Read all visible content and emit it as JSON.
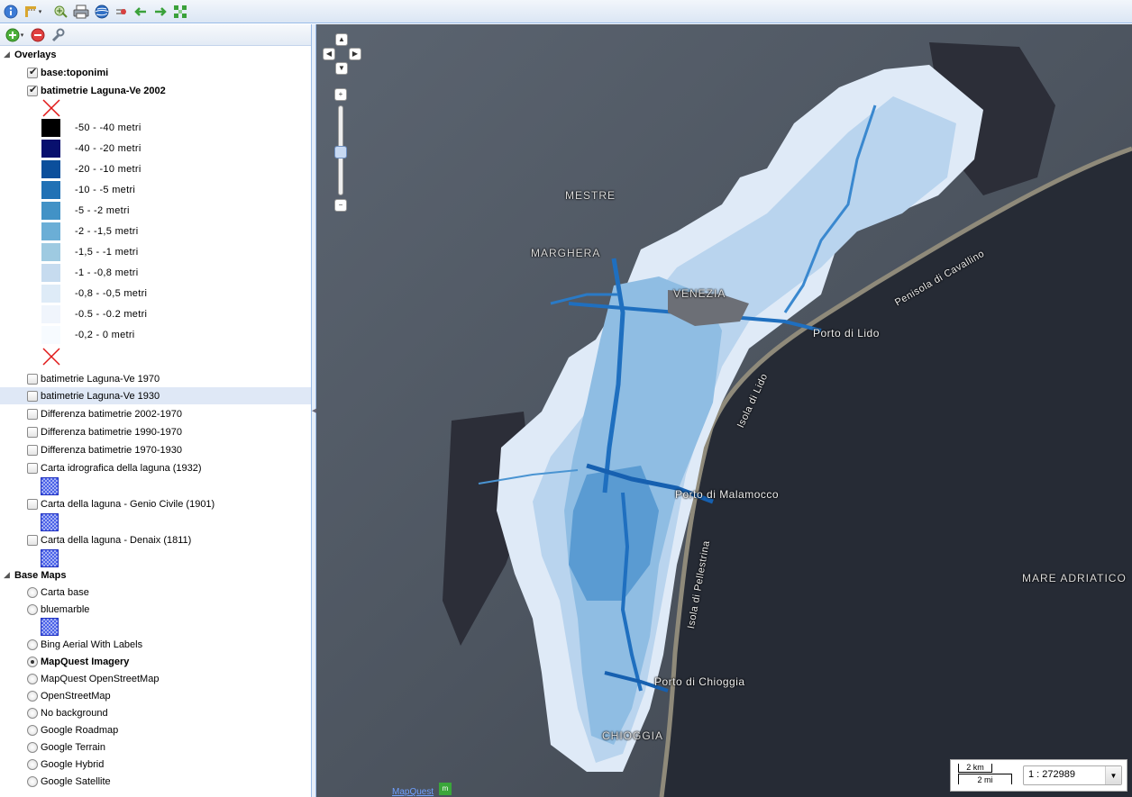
{
  "toolbar": {
    "buttons": [
      "info-icon",
      "measure-icon",
      "zoom-to-layer-icon",
      "print-icon",
      "globe-icon",
      "remove-icon",
      "back-icon",
      "forward-icon",
      "full-extent-icon"
    ]
  },
  "layer_panel": {
    "toolbar": [
      "add-layer-icon",
      "remove-layer-icon",
      "properties-icon"
    ],
    "overlays": {
      "label": "Overlays",
      "layers": [
        {
          "label": "base:toponimi",
          "checked": true,
          "bold": true
        },
        {
          "label": "batimetrie Laguna-Ve 2002",
          "checked": true,
          "bold": true
        },
        {
          "label": "batimetrie Laguna-Ve 1970",
          "checked": false
        },
        {
          "label": "batimetrie Laguna-Ve 1930",
          "checked": false,
          "selected": true
        },
        {
          "label": "Differenza batimetrie 2002-1970",
          "checked": false
        },
        {
          "label": "Differenza batimetrie 1990-1970",
          "checked": false
        },
        {
          "label": "Differenza batimetrie 1970-1930",
          "checked": false
        },
        {
          "label": "Carta idrografica della laguna (1932)",
          "checked": false
        },
        {
          "label": "Carta della laguna - Genio Civile (1901)",
          "checked": false
        },
        {
          "label": "Carta della laguna - Denaix (1811)",
          "checked": false
        }
      ],
      "legend": [
        {
          "label": "-50 - -40 metri",
          "color": "#000000"
        },
        {
          "label": "-40 - -20 metri",
          "color": "#08106e"
        },
        {
          "label": "-20 - -10 metri",
          "color": "#0b4f9c"
        },
        {
          "label": "-10 - -5 metri",
          "color": "#2171b5"
        },
        {
          "label": "-5 - -2 metri",
          "color": "#4292c6"
        },
        {
          "label": "-2 - -1,5 metri",
          "color": "#6baed6"
        },
        {
          "label": "-1,5 - -1 metri",
          "color": "#9ecae1"
        },
        {
          "label": "-1 - -0,8 metri",
          "color": "#c6dbef"
        },
        {
          "label": "-0,8 - -0,5 metri",
          "color": "#deebf7"
        },
        {
          "label": "-0.5 - -0.2 metri",
          "color": "#f0f5fc"
        },
        {
          "label": "-0,2 - 0 metri",
          "color": "#f7fbff"
        }
      ]
    },
    "base_maps": {
      "label": "Base Maps",
      "layers": [
        {
          "label": "Carta base",
          "checked": false
        },
        {
          "label": "bluemarble",
          "checked": false
        },
        {
          "label": "Bing Aerial With Labels",
          "checked": false
        },
        {
          "label": "MapQuest Imagery",
          "checked": true,
          "bold": true
        },
        {
          "label": "MapQuest OpenStreetMap",
          "checked": false
        },
        {
          "label": "OpenStreetMap",
          "checked": false
        },
        {
          "label": "No background",
          "checked": false
        },
        {
          "label": "Google Roadmap",
          "checked": false
        },
        {
          "label": "Google Terrain",
          "checked": false
        },
        {
          "label": "Google Hybrid",
          "checked": false
        },
        {
          "label": "Google Satellite",
          "checked": false
        }
      ]
    }
  },
  "map": {
    "labels": {
      "mestre": "MESTRE",
      "marghera": "MARGHERA",
      "venezia": "VENEZIA",
      "porto_lido": "Porto di Lido",
      "penisola": "Penisola di Cavallino",
      "isola_lido": "Isola di Lido",
      "porto_malamocco": "Porto di Malamocco",
      "isola_pellestrina": "Isola di Pellestrina",
      "mare": "MARE ADRIATICO",
      "porto_chioggia": "Porto di Chioggia",
      "chioggia": "CHIOGGIA"
    },
    "zoom": {
      "in": "+",
      "out": "−"
    },
    "scale": {
      "km": "2 km",
      "mi": "2 mi",
      "ratio": "1 : 272989"
    },
    "attribution": "MapQuest"
  }
}
